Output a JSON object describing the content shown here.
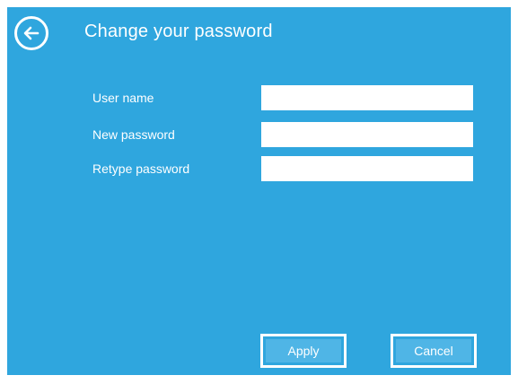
{
  "header": {
    "title": "Change your password",
    "back_icon": "back-arrow-icon"
  },
  "form": {
    "fields": [
      {
        "label": "User name",
        "value": "",
        "placeholder": ""
      },
      {
        "label": "New password",
        "value": "",
        "placeholder": ""
      },
      {
        "label": "Retype password",
        "value": "",
        "placeholder": ""
      }
    ]
  },
  "actions": {
    "apply_label": "Apply",
    "cancel_label": "Cancel"
  },
  "colors": {
    "background": "#2fa6de",
    "foreground": "#ffffff"
  }
}
